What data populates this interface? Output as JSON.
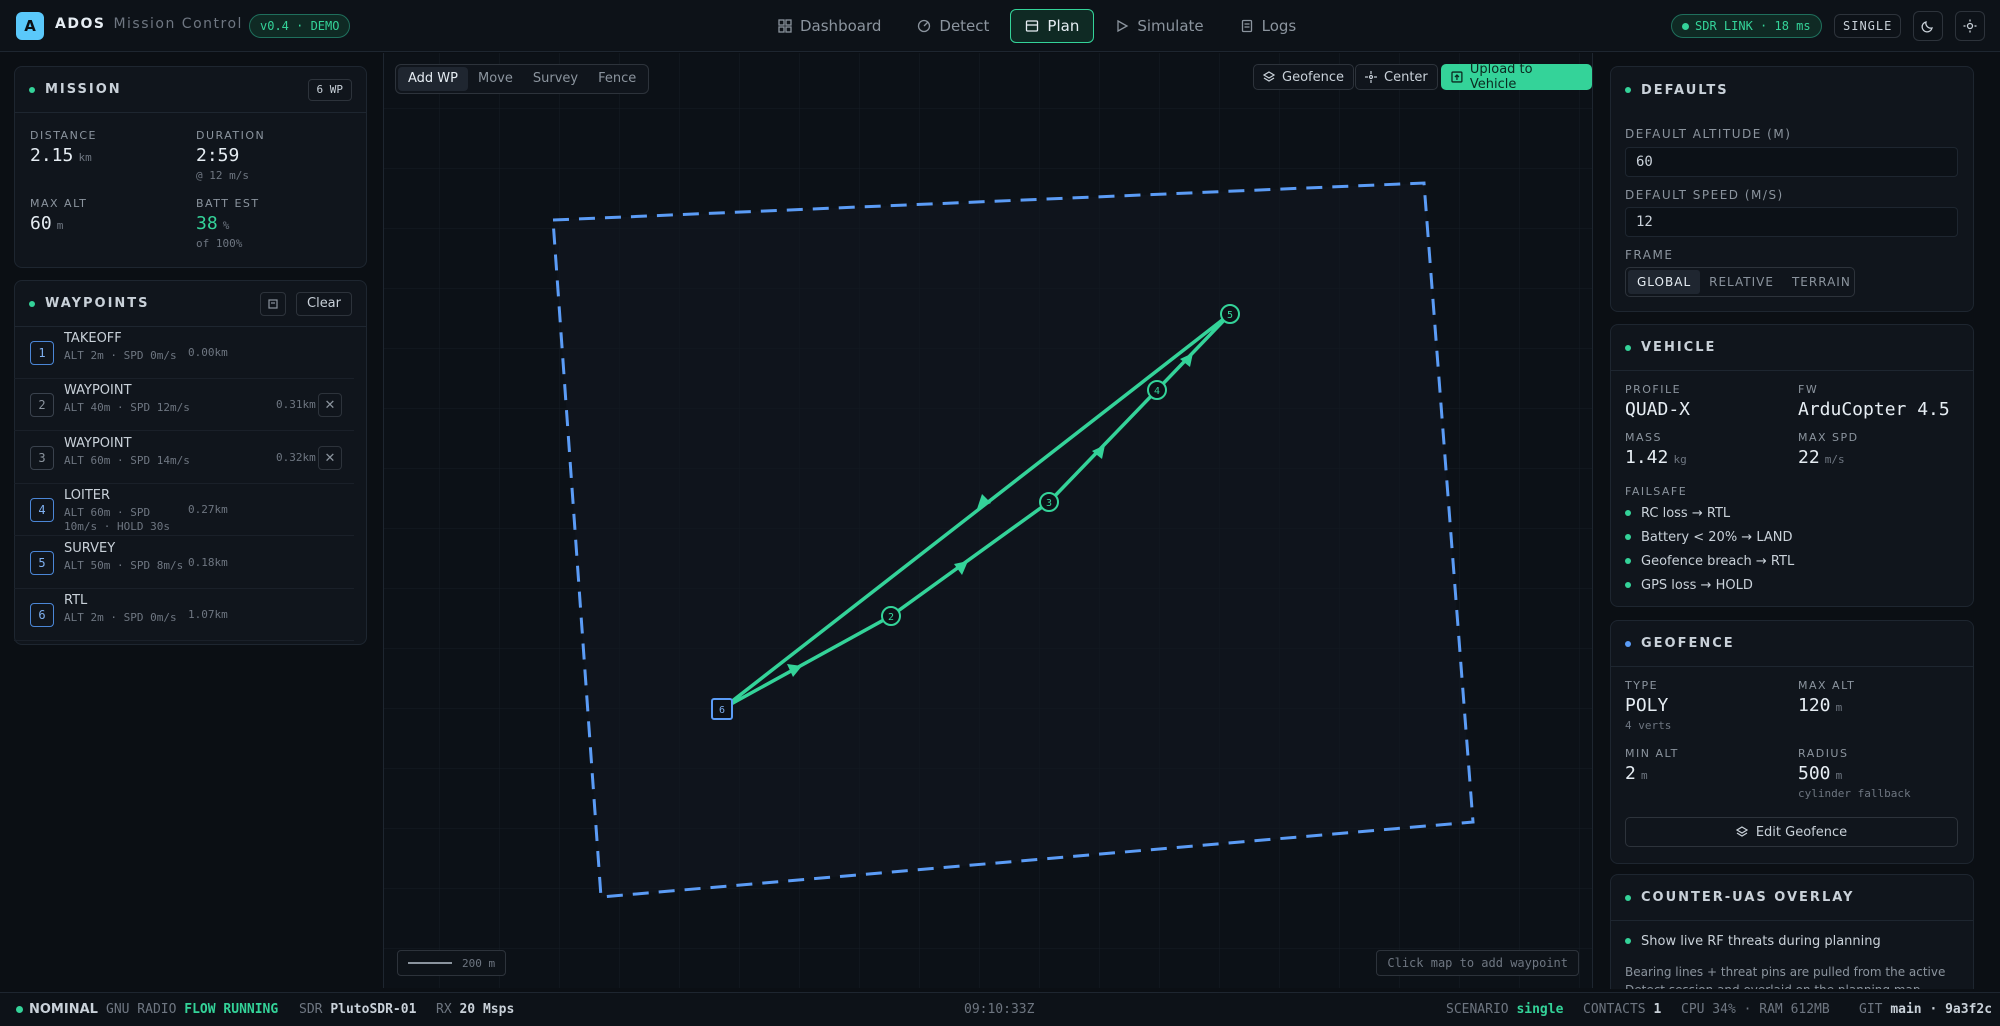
{
  "app": {
    "logo_letter": "A",
    "name": "ADOS",
    "subtitle": "Mission Control",
    "version": "v0.4 · DEMO"
  },
  "nav": {
    "tabs": [
      {
        "label": "Dashboard",
        "icon": "grid-icon"
      },
      {
        "label": "Detect",
        "icon": "radar-icon"
      },
      {
        "label": "Plan",
        "icon": "map-icon",
        "active": true
      },
      {
        "label": "Simulate",
        "icon": "play-icon"
      },
      {
        "label": "Logs",
        "icon": "doc-icon"
      }
    ]
  },
  "header_right": {
    "sdr_link": "SDR LINK · 18 ms",
    "mode": "SINGLE"
  },
  "mission": {
    "title": "MISSION",
    "wp_badge": "6 WP",
    "distance_label": "DISTANCE",
    "distance": "2.15",
    "distance_unit": "km",
    "duration_label": "DURATION",
    "duration": "2:59",
    "duration_sub": "@ 12 m/s",
    "max_alt_label": "MAX ALT",
    "max_alt": "60",
    "max_alt_unit": "m",
    "batt_label": "BATT EST",
    "batt": "38",
    "batt_unit": "%",
    "batt_sub": "of 100%"
  },
  "waypoints": {
    "title": "WAYPOINTS",
    "clear_label": "Clear",
    "items": [
      {
        "n": "1",
        "type": "TAKEOFF",
        "meta": "ALT 2m · SPD 0m/s",
        "dist": "0.00km"
      },
      {
        "n": "2",
        "type": "WAYPOINT",
        "meta": "ALT 40m · SPD 12m/s",
        "dist": "0.31km"
      },
      {
        "n": "3",
        "type": "WAYPOINT",
        "meta": "ALT 60m · SPD 14m/s",
        "dist": "0.32km"
      },
      {
        "n": "4",
        "type": "LOITER",
        "meta": "ALT 60m · SPD 10m/s · HOLD 30s",
        "dist": "0.27km"
      },
      {
        "n": "5",
        "type": "SURVEY",
        "meta": "ALT 50m · SPD 8m/s",
        "dist": "0.18km"
      },
      {
        "n": "6",
        "type": "RTL",
        "meta": "ALT 2m · SPD 0m/s",
        "dist": "1.07km"
      }
    ]
  },
  "map": {
    "modes": [
      "Add WP",
      "Move",
      "Survey",
      "Fence"
    ],
    "geofence_btn": "Geofence",
    "center_btn": "Center",
    "upload_btn": "Upload to Vehicle",
    "scale": "200 m",
    "hint": "Click map to add waypoint",
    "route_color": "#34d399",
    "fence_color": "#5b9cf6"
  },
  "defaults": {
    "title": "DEFAULTS",
    "alt_label": "DEFAULT ALTITUDE (M)",
    "alt_value": "60",
    "speed_label": "DEFAULT SPEED (M/S)",
    "speed_value": "12",
    "frame_label": "FRAME",
    "frames": [
      "GLOBAL",
      "RELATIVE",
      "TERRAIN"
    ]
  },
  "vehicle": {
    "title": "VEHICLE",
    "profile_label": "PROFILE",
    "profile": "QUAD-X",
    "fw_label": "FW",
    "fw": "ArduCopter 4.5",
    "mass_label": "MASS",
    "mass": "1.42",
    "mass_unit": "kg",
    "maxspd_label": "MAX SPD",
    "maxspd": "22",
    "maxspd_unit": "m/s",
    "failsafe_label": "FAILSAFE",
    "failsafe": [
      "RC loss → RTL",
      "Battery < 20% → LAND",
      "Geofence breach → RTL",
      "GPS loss → HOLD"
    ]
  },
  "geofence": {
    "title": "GEOFENCE",
    "type_label": "TYPE",
    "type": "POLY",
    "type_sub": "4 verts",
    "maxalt_label": "MAX ALT",
    "maxalt": "120",
    "maxalt_unit": "m",
    "minalt_label": "MIN ALT",
    "minalt": "2",
    "minalt_unit": "m",
    "radius_label": "RADIUS",
    "radius": "500",
    "radius_unit": "m",
    "radius_sub": "cylinder fallback",
    "edit_btn": "Edit Geofence"
  },
  "counter_uas": {
    "title": "COUNTER-UAS OVERLAY",
    "toggle_label": "Show live RF threats during planning",
    "desc": "Bearing lines + threat pins are pulled from the active Detect session and overlaid on the planning map. Routes auto-flag"
  },
  "status": {
    "nominal": "NOMINAL",
    "gnu_label": "GNU RADIO",
    "gnu_value": "FLOW RUNNING",
    "sdr_label": "SDR",
    "sdr_value": "PlutoSDR-01",
    "rx_label": "RX",
    "rx_value": "20 Msps",
    "time": "09:10:33Z",
    "scenario_label": "SCENARIO",
    "scenario_value": "single",
    "contacts_label": "CONTACTS",
    "contacts_value": "1",
    "cpu": "CPU 34% · RAM 612MB",
    "git_label": "GIT",
    "git_value": "main · 9a3f2c"
  }
}
